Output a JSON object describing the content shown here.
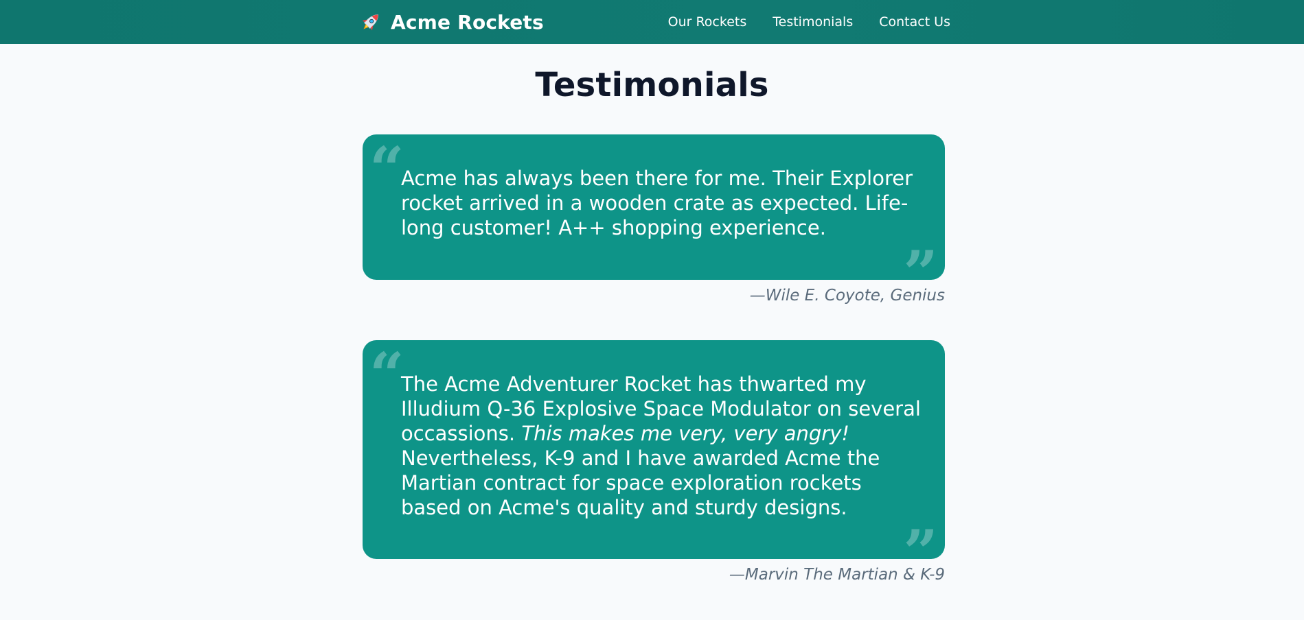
{
  "header": {
    "brand_name": "Acme Rockets",
    "nav": [
      {
        "label": "Our Rockets"
      },
      {
        "label": "Testimonials"
      },
      {
        "label": "Contact Us"
      }
    ]
  },
  "page": {
    "title": "Testimonials"
  },
  "testimonials": [
    {
      "text": "Acme has always been there for me. Their Explorer rocket arrived in a wooden crate as expected. Life-long customer! A++ shopping experience.",
      "attribution": "—Wile E. Coyote, Genius"
    },
    {
      "text_before": "The Acme Adventurer Rocket has thwarted my Illudium Q-36 Explosive Space Modulator on several occassions.",
      "text_emphasis": "This makes me very, very angry!",
      "text_after": "Nevertheless, K-9 and I have awarded Acme the Martian contract for space exploration rockets based on Acme's quality and sturdy designs.",
      "attribution": "—Marvin The Martian & K-9"
    }
  ],
  "colors": {
    "header_bg": "#0f766e",
    "card_bg": "#0e9488",
    "page_bg": "#f8fafc",
    "attribution": "#5a6b7b"
  },
  "icons": {
    "brand": "rocket-icon",
    "open_quote": "open-quote-icon",
    "close_quote": "close-quote-icon"
  }
}
